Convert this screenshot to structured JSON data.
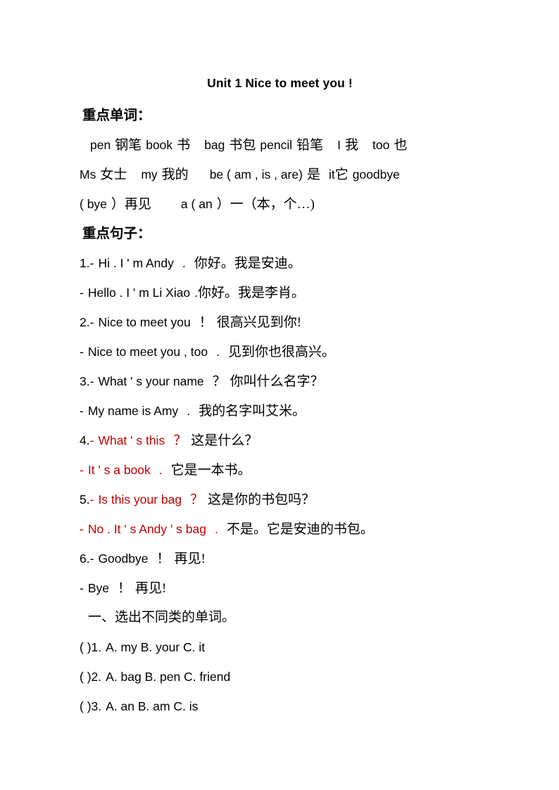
{
  "document": {
    "title": "Unit 1 Nice to meet you !",
    "accent_red": "#C00000",
    "text_color": "#000000",
    "background": "#ffffff"
  },
  "vocabulary": {
    "heading": "重点单词：",
    "lines": [
      {
        "parts": [
          {
            "t": "pen",
            "lang": "en"
          },
          {
            "t": "钢笔",
            "lang": "cn"
          },
          {
            "t": "book",
            "lang": "en"
          },
          {
            "t": "书",
            "lang": "cn"
          },
          {
            "t": "bag",
            "lang": "en"
          },
          {
            "t": "书包",
            "lang": "cn"
          },
          {
            "t": "pencil",
            "lang": "en"
          },
          {
            "t": "铅笔",
            "lang": "cn"
          },
          {
            "t": "I",
            "lang": "en"
          },
          {
            "t": "我",
            "lang": "cn"
          },
          {
            "t": "too",
            "lang": "en"
          },
          {
            "t": "也",
            "lang": "cn"
          }
        ]
      },
      {
        "parts": [
          {
            "t": "Ms",
            "lang": "en"
          },
          {
            "t": "女士",
            "lang": "cn"
          },
          {
            "t": "my",
            "lang": "en"
          },
          {
            "t": "我的",
            "lang": "cn"
          },
          {
            "t": "be ( am , is , are)",
            "lang": "en"
          },
          {
            "t": "是",
            "lang": "cn"
          },
          {
            "t": "it",
            "lang": "en"
          },
          {
            "t": "它",
            "lang": "cn"
          },
          {
            "t": "goodbye",
            "lang": "en"
          }
        ]
      },
      {
        "parts": [
          {
            "t": "( bye",
            "lang": "en"
          },
          {
            "t": "）再见",
            "lang": "cn"
          },
          {
            "t": "a ( an",
            "lang": "en"
          },
          {
            "t": "）一（本，个…)",
            "lang": "cn"
          }
        ]
      }
    ],
    "line1_text": "pen 钢笔 book 书  bag 书包 pencil 铅笔  I 我  too 也",
    "line2_text": "Ms 女士  my 我的   be ( am , is , are) 是  it 它 goodbye",
    "line3_text": "( bye ）再见    a ( an ）一（本，个…)"
  },
  "sentences": {
    "heading": "重点句子：",
    "items": [
      {
        "number": "1.",
        "dash": "-",
        "en": "Hi . I ' m Andy",
        "punct": ".",
        "cn": "你好。我是安迪。",
        "en_red": false,
        "reply_dash": "-",
        "reply_en": "Hello . I ' m Li Xiao",
        "reply_punct": ".",
        "reply_cn": "你好。我是李肖。",
        "reply_red": false
      },
      {
        "number": "2.",
        "dash": "-",
        "en": "Nice to meet you",
        "punct": "！",
        "cn": "很高兴见到你!",
        "en_red": false,
        "reply_dash": "-",
        "reply_en": "Nice to meet you , too",
        "reply_punct": ".",
        "reply_cn": "见到你也很高兴。",
        "reply_red": false
      },
      {
        "number": "3.",
        "dash": "-",
        "en": "What ' s your name",
        "punct": "？",
        "cn": "你叫什么名字？",
        "en_red": false,
        "reply_dash": "-",
        "reply_en": "My name is Amy",
        "reply_punct": ".",
        "reply_cn": "我的名字叫艾米。",
        "reply_red": false
      },
      {
        "number": "4.",
        "dash": "-",
        "en": "What ' s this",
        "punct": "？",
        "cn": "这是什么？",
        "en_red": true,
        "reply_dash": "-",
        "reply_en": "It ' s a book",
        "reply_punct": ".",
        "reply_cn": "它是一本书。",
        "reply_red": true
      },
      {
        "number": "5.",
        "dash": "-",
        "en": "Is this your bag",
        "punct": "？",
        "cn": "这是你的书包吗？",
        "en_red": true,
        "reply_dash": "-",
        "reply_en": "No . It ' s Andy ' s bag",
        "reply_punct": ".",
        "reply_cn": "不是。它是安迪的书包。",
        "reply_red": true
      },
      {
        "number": "6.",
        "dash": "-",
        "en": "Goodbye",
        "punct": "！",
        "cn": "再见!",
        "en_red": false,
        "reply_dash": "-",
        "reply_en": "Bye",
        "reply_punct": "！",
        "reply_cn": "再见!",
        "reply_red": false
      }
    ]
  },
  "exercise": {
    "heading": "一、选出不同类的单词。",
    "items": [
      {
        "bracket": "( )",
        "number": "1.",
        "options": "A. my B. your C. it"
      },
      {
        "bracket": "( )",
        "number": "2.",
        "options": "A. bag B. pen C. friend"
      },
      {
        "bracket": "( )",
        "number": "3.",
        "options": "A. an B. am C. is"
      }
    ]
  }
}
